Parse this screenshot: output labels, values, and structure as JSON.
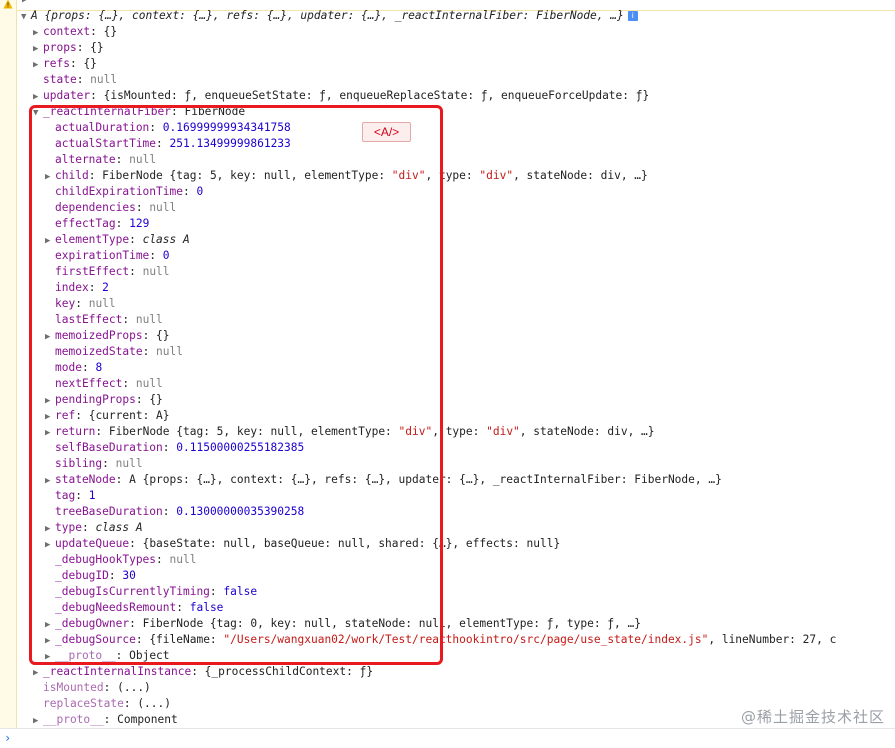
{
  "console": {
    "top_arrow": "▶",
    "root_summary": "A {props: {…}, context: {…}, refs: {…}, updater: {…}, _reactInternalFiber: FiberNode, …}",
    "info_badge": "i",
    "prompt": "›",
    "watermark": "@稀土掘金技术社区"
  },
  "overlay": {
    "component_label": "<A/>"
  },
  "rows": [
    {
      "tri": "▶",
      "key": "context",
      "sep": ": ",
      "val": "{}",
      "vclass": "plain",
      "kclass": "key-purple",
      "indent": 1
    },
    {
      "tri": "▶",
      "key": "props",
      "sep": ": ",
      "val": "{}",
      "vclass": "plain",
      "kclass": "key-purple",
      "indent": 1
    },
    {
      "tri": "▶",
      "key": "refs",
      "sep": ": ",
      "val": "{}",
      "vclass": "plain",
      "kclass": "key-purple",
      "indent": 1
    },
    {
      "tri": "",
      "key": "state",
      "sep": ": ",
      "val": "null",
      "vclass": "nullv",
      "kclass": "key-purple",
      "indent": 1
    },
    {
      "tri": "▶",
      "key": "updater",
      "sep": ": ",
      "val": "{isMounted: ƒ, enqueueSetState: ƒ, enqueueReplaceState: ƒ, enqueueForceUpdate: ƒ}",
      "vclass": "plain",
      "kclass": "key-purple",
      "indent": 1
    },
    {
      "tri": "▼",
      "key": "_reactInternalFiber",
      "sep": ": ",
      "val": "FiberNode",
      "vclass": "plain",
      "kclass": "key-purple",
      "indent": 1
    },
    {
      "tri": "",
      "key": "actualDuration",
      "sep": ": ",
      "val": "0.16999999934341758",
      "vclass": "num",
      "kclass": "key-purple",
      "indent": 2
    },
    {
      "tri": "",
      "key": "actualStartTime",
      "sep": ": ",
      "val": "251.13499999861233",
      "vclass": "num",
      "kclass": "key-purple",
      "indent": 2
    },
    {
      "tri": "",
      "key": "alternate",
      "sep": ": ",
      "val": "null",
      "vclass": "nullv",
      "kclass": "key-purple",
      "indent": 2
    },
    {
      "tri": "▶",
      "key": "child",
      "sep": ": ",
      "val": "FiberNode {tag: 5, key: null, elementType: \"div\", type: \"div\", stateNode: div, …}",
      "vclass": "plain",
      "kclass": "key-purple",
      "indent": 2
    },
    {
      "tri": "",
      "key": "childExpirationTime",
      "sep": ": ",
      "val": "0",
      "vclass": "num",
      "kclass": "key-purple",
      "indent": 2
    },
    {
      "tri": "",
      "key": "dependencies",
      "sep": ": ",
      "val": "null",
      "vclass": "nullv",
      "kclass": "key-purple",
      "indent": 2
    },
    {
      "tri": "",
      "key": "effectTag",
      "sep": ": ",
      "val": "129",
      "vclass": "num",
      "kclass": "key-purple",
      "indent": 2
    },
    {
      "tri": "▶",
      "key": "elementType",
      "sep": ": ",
      "val": "class A",
      "vclass": "italic",
      "kclass": "key-purple",
      "indent": 2
    },
    {
      "tri": "",
      "key": "expirationTime",
      "sep": ": ",
      "val": "0",
      "vclass": "num",
      "kclass": "key-purple",
      "indent": 2
    },
    {
      "tri": "",
      "key": "firstEffect",
      "sep": ": ",
      "val": "null",
      "vclass": "nullv",
      "kclass": "key-purple",
      "indent": 2
    },
    {
      "tri": "",
      "key": "index",
      "sep": ": ",
      "val": "2",
      "vclass": "num",
      "kclass": "key-purple",
      "indent": 2
    },
    {
      "tri": "",
      "key": "key",
      "sep": ": ",
      "val": "null",
      "vclass": "nullv",
      "kclass": "key-purple",
      "indent": 2
    },
    {
      "tri": "",
      "key": "lastEffect",
      "sep": ": ",
      "val": "null",
      "vclass": "nullv",
      "kclass": "key-purple",
      "indent": 2
    },
    {
      "tri": "▶",
      "key": "memoizedProps",
      "sep": ": ",
      "val": "{}",
      "vclass": "plain",
      "kclass": "key-purple",
      "indent": 2
    },
    {
      "tri": "",
      "key": "memoizedState",
      "sep": ": ",
      "val": "null",
      "vclass": "nullv",
      "kclass": "key-purple",
      "indent": 2
    },
    {
      "tri": "",
      "key": "mode",
      "sep": ": ",
      "val": "8",
      "vclass": "num",
      "kclass": "key-purple",
      "indent": 2
    },
    {
      "tri": "",
      "key": "nextEffect",
      "sep": ": ",
      "val": "null",
      "vclass": "nullv",
      "kclass": "key-purple",
      "indent": 2
    },
    {
      "tri": "▶",
      "key": "pendingProps",
      "sep": ": ",
      "val": "{}",
      "vclass": "plain",
      "kclass": "key-purple",
      "indent": 2
    },
    {
      "tri": "▶",
      "key": "ref",
      "sep": ": ",
      "val": "{current: A}",
      "vclass": "plain",
      "kclass": "key-purple",
      "indent": 2
    },
    {
      "tri": "▶",
      "key": "return",
      "sep": ": ",
      "val": "FiberNode {tag: 5, key: null, elementType: \"div\", type: \"div\", stateNode: div, …}",
      "vclass": "plain",
      "kclass": "key-purple",
      "indent": 2
    },
    {
      "tri": "",
      "key": "selfBaseDuration",
      "sep": ": ",
      "val": "0.11500000255182385",
      "vclass": "num",
      "kclass": "key-purple",
      "indent": 2
    },
    {
      "tri": "",
      "key": "sibling",
      "sep": ": ",
      "val": "null",
      "vclass": "nullv",
      "kclass": "key-purple",
      "indent": 2
    },
    {
      "tri": "▶",
      "key": "stateNode",
      "sep": ": ",
      "val": "A {props: {…}, context: {…}, refs: {…}, updater: {…}, _reactInternalFiber: FiberNode, …}",
      "vclass": "plain",
      "kclass": "key-purple",
      "indent": 2
    },
    {
      "tri": "",
      "key": "tag",
      "sep": ": ",
      "val": "1",
      "vclass": "num",
      "kclass": "key-purple",
      "indent": 2
    },
    {
      "tri": "",
      "key": "treeBaseDuration",
      "sep": ": ",
      "val": "0.13000000035390258",
      "vclass": "num",
      "kclass": "key-purple",
      "indent": 2
    },
    {
      "tri": "▶",
      "key": "type",
      "sep": ": ",
      "val": "class A",
      "vclass": "italic",
      "kclass": "key-purple",
      "indent": 2
    },
    {
      "tri": "▶",
      "key": "updateQueue",
      "sep": ": ",
      "val": "{baseState: null, baseQueue: null, shared: {…}, effects: null}",
      "vclass": "plain",
      "kclass": "key-purple",
      "indent": 2
    },
    {
      "tri": "",
      "key": "_debugHookTypes",
      "sep": ": ",
      "val": "null",
      "vclass": "nullv",
      "kclass": "key-purple",
      "indent": 2
    },
    {
      "tri": "",
      "key": "_debugID",
      "sep": ": ",
      "val": "30",
      "vclass": "num",
      "kclass": "key-purple",
      "indent": 2
    },
    {
      "tri": "",
      "key": "_debugIsCurrentlyTiming",
      "sep": ": ",
      "val": "false",
      "vclass": "num",
      "kclass": "key-purple",
      "indent": 2
    },
    {
      "tri": "",
      "key": "_debugNeedsRemount",
      "sep": ": ",
      "val": "false",
      "vclass": "num",
      "kclass": "key-purple",
      "indent": 2
    },
    {
      "tri": "▶",
      "key": "_debugOwner",
      "sep": ": ",
      "val": "FiberNode {tag: 0, key: null, stateNode: null, elementType: ƒ, type: ƒ, …}",
      "vclass": "plain",
      "kclass": "key-purple",
      "indent": 2
    },
    {
      "tri": "▶",
      "key": "_debugSource",
      "sep": ": ",
      "val": "{fileName: \"/Users/wangxuan02/work/Test/reacthookintro/src/page/use_state/index.js\", lineNumber: 27, c",
      "vclass": "plain",
      "kclass": "key-purple",
      "indent": 2
    },
    {
      "tri": "▶",
      "key": "__proto__",
      "sep": ": ",
      "val": "Object",
      "vclass": "plain",
      "kclass": "key-dim",
      "indent": 2
    },
    {
      "tri": "▶",
      "key": "_reactInternalInstance",
      "sep": ": ",
      "val": "{_processChildContext: ƒ}",
      "vclass": "plain",
      "kclass": "key-purple",
      "indent": 1
    },
    {
      "tri": "",
      "key": "isMounted",
      "sep": ": ",
      "val": "(...)",
      "vclass": "plain",
      "kclass": "key-dim",
      "indent": 1
    },
    {
      "tri": "",
      "key": "replaceState",
      "sep": ": ",
      "val": "(...)",
      "vclass": "plain",
      "kclass": "key-dim",
      "indent": 1
    },
    {
      "tri": "▶",
      "key": "__proto__",
      "sep": ": ",
      "val": "Component",
      "vclass": "plain",
      "kclass": "key-dim",
      "indent": 1
    }
  ]
}
